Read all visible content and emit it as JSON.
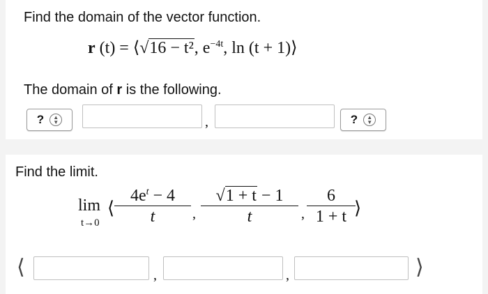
{
  "q1": {
    "prompt": "Find the domain of the vector function.",
    "func_lhs": "r",
    "func_arg": " (t) = ⟨",
    "sqrt_arg": "16 − t²",
    "func_rest": ", e",
    "exp": "−4t",
    "func_end": ", ln (t + 1)⟩",
    "answer_label_pre": "The domain of ",
    "answer_label_bold": "r",
    "answer_label_post": " is the following.",
    "left_select": "?",
    "right_select": "?",
    "comma": ","
  },
  "q2": {
    "prompt": "Find the limit.",
    "lim_word": "lim",
    "lim_sub": "t→0",
    "open_angle": "⟨",
    "close_angle": "⟩",
    "frac1_num": "4e",
    "frac1_num_sup": "t",
    "frac1_num_rest": " − 4",
    "frac1_den": "t",
    "frac2_num_sqrt": "1 + t",
    "frac2_num_rest": " − 1",
    "frac2_den": "t",
    "frac3_num": "6",
    "frac3_den": "1 + t",
    "sep": ",",
    "answer_open": "⟨",
    "answer_close": "⟩",
    "comma": ","
  }
}
